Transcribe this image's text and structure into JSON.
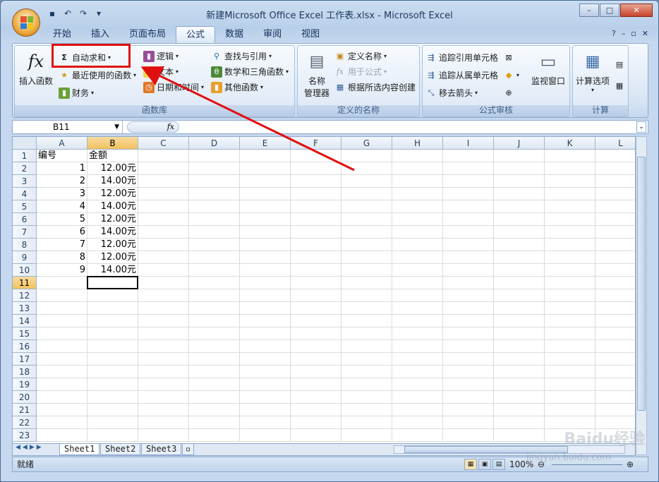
{
  "window": {
    "title": "新建Microsoft Office Excel 工作表.xlsx - Microsoft Excel"
  },
  "tabs": [
    "开始",
    "插入",
    "页面布局",
    "公式",
    "数据",
    "审阅",
    "视图"
  ],
  "active_tab": "公式",
  "ribbon": {
    "insert_function": "插入函数",
    "autosum": "自动求和",
    "recent": "最近使用的函数",
    "financial": "财务",
    "logical": "逻辑",
    "text": "文本",
    "datetime": "日期和时间",
    "lookup": "查找与引用",
    "math": "数学和三角函数",
    "other": "其他函数",
    "group_library": "函数库",
    "name_manager_1": "名称",
    "name_manager_2": "管理器",
    "define_name": "定义名称",
    "use_in_formula": "用于公式",
    "create_from_selection": "根据所选内容创建",
    "group_names": "定义的名称",
    "trace_precedents": "追踪引用单元格",
    "trace_dependents": "追踪从属单元格",
    "remove_arrows": "移去箭头",
    "watch_window": "监视窗口",
    "group_audit": "公式审核",
    "calc_options": "计算选项",
    "group_calc": "计算"
  },
  "formula_bar": {
    "name_box": "B11",
    "fx": "fx"
  },
  "columns": [
    "A",
    "B",
    "C",
    "D",
    "E",
    "F",
    "G",
    "H",
    "I",
    "J",
    "K",
    "L"
  ],
  "rows": [
    "1",
    "2",
    "3",
    "4",
    "5",
    "6",
    "7",
    "8",
    "9",
    "10",
    "11",
    "12",
    "13",
    "14",
    "15",
    "16",
    "17",
    "18",
    "19",
    "20",
    "21",
    "22",
    "23"
  ],
  "cells": {
    "header_a": "编号",
    "header_b": "金额",
    "a": [
      "1",
      "2",
      "3",
      "4",
      "5",
      "6",
      "7",
      "8",
      "9"
    ],
    "b": [
      "12.00元",
      "14.00元",
      "12.00元",
      "14.00元",
      "12.00元",
      "14.00元",
      "12.00元",
      "12.00元",
      "14.00元"
    ]
  },
  "sheets": [
    "Sheet1",
    "Sheet2",
    "Sheet3"
  ],
  "status": "就绪",
  "zoom": "100%",
  "watermark": "Baidu经验",
  "watermark_url": "jingyan.baidu.com"
}
